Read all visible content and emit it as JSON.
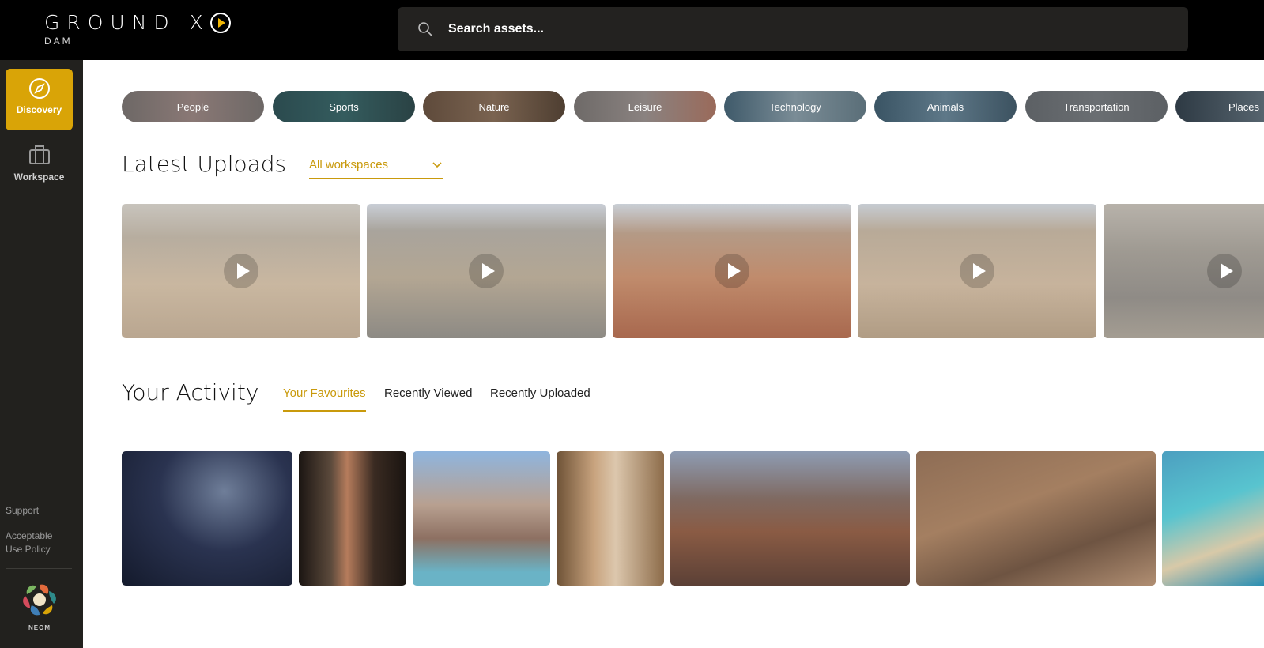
{
  "header": {
    "logo_text": "GROUND X",
    "logo_sub": "DAM",
    "search_placeholder": "Search assets..."
  },
  "sidebar": {
    "items": [
      {
        "label": "Discovery",
        "icon": "compass-icon",
        "active": true
      },
      {
        "label": "Workspace",
        "icon": "briefcase-icon",
        "active": false
      }
    ],
    "links": [
      "Support",
      "Acceptable Use Policy"
    ],
    "brand_label": "NEOM"
  },
  "categories": [
    "People",
    "Sports",
    "Nature",
    "Leisure",
    "Technology",
    "Animals",
    "Transportation",
    "Places"
  ],
  "latest_uploads": {
    "title": "Latest Uploads",
    "workspace_select": "All workspaces"
  },
  "activity": {
    "title": "Your Activity",
    "tabs": [
      "Your Favourites",
      "Recently Viewed",
      "Recently Uploaded"
    ],
    "active_tab": "Your Favourites"
  },
  "colors": {
    "accent": "#d9a407",
    "sidebar_bg": "#22211e",
    "topbar_bg": "#000000",
    "search_bg": "#232220"
  }
}
